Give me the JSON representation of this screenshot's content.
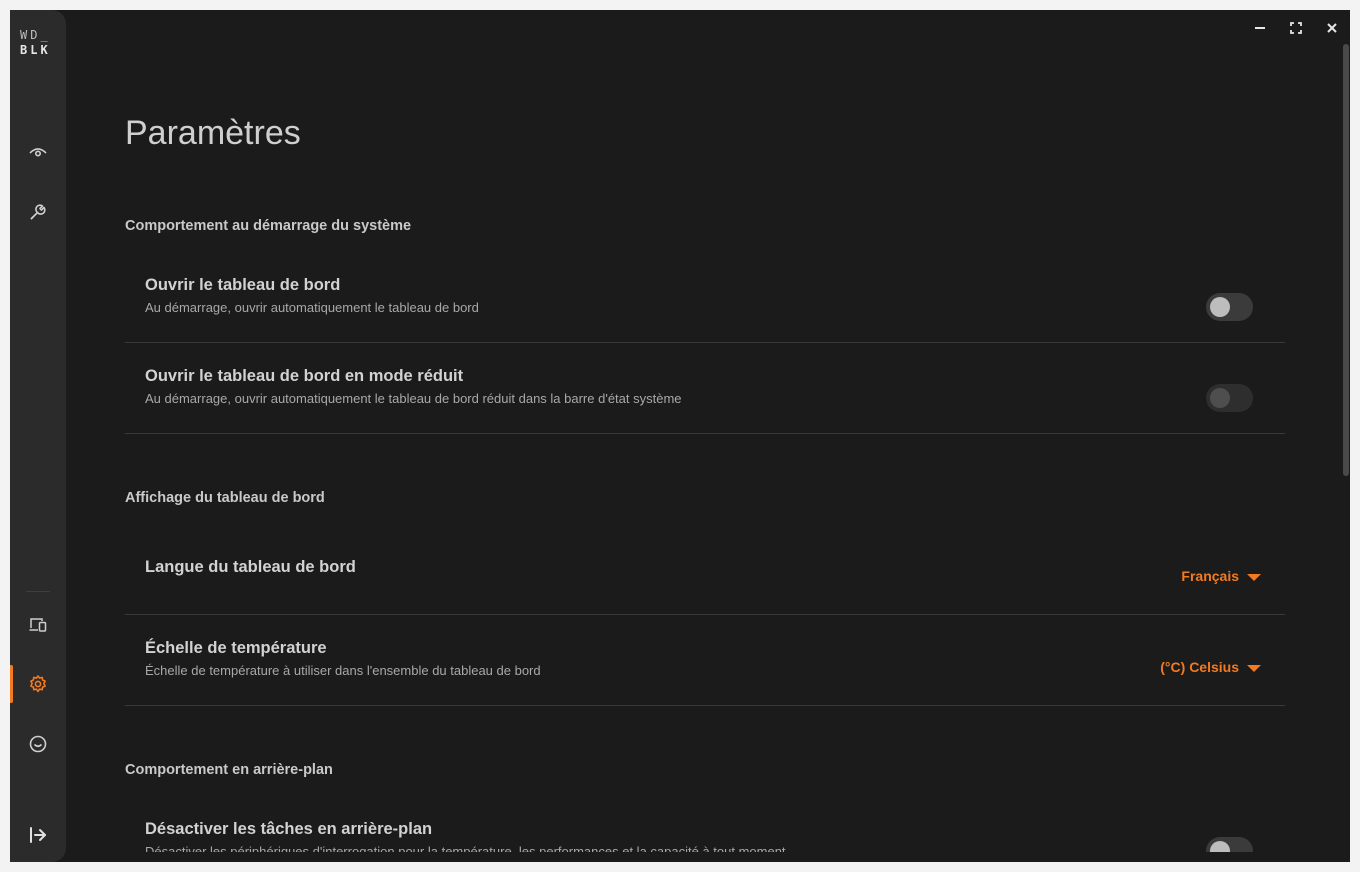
{
  "app": {
    "logo_line1": "WD_",
    "logo_line2": "BLK"
  },
  "colors": {
    "accent": "#f47a20",
    "background": "#1b1b1b",
    "sidebar": "#2b2b2b"
  },
  "sidebar": {
    "items": [
      {
        "icon": "eye-icon",
        "active": false
      },
      {
        "icon": "wrench-icon",
        "active": false
      },
      {
        "icon": "devices-icon",
        "active": false
      },
      {
        "icon": "gear-icon",
        "active": true
      },
      {
        "icon": "smiley-feedback-icon",
        "active": false
      },
      {
        "icon": "logout-arrow-icon",
        "active": false
      }
    ]
  },
  "window_controls": [
    "minimize-icon",
    "maximize-icon",
    "close-icon"
  ],
  "page": {
    "title": "Paramètres",
    "sections": [
      {
        "heading": "Comportement au démarrage du système",
        "rows": [
          {
            "title": "Ouvrir le tableau de bord",
            "description": "Au démarrage, ouvrir automatiquement le tableau de bord",
            "control": "toggle",
            "on": false
          },
          {
            "title": "Ouvrir le tableau de bord en mode réduit",
            "description": "Au démarrage, ouvrir automatiquement le tableau de bord réduit dans la barre d'état système",
            "control": "toggle",
            "on": false,
            "disabled": true
          }
        ]
      },
      {
        "heading": "Affichage du tableau de bord",
        "rows": [
          {
            "title": "Langue du tableau de bord",
            "control": "dropdown",
            "value": "Français"
          },
          {
            "title": "Échelle de température",
            "description": "Échelle de température à utiliser dans l'ensemble du tableau de bord",
            "control": "dropdown",
            "value": "(°C) Celsius"
          }
        ]
      },
      {
        "heading": "Comportement en arrière-plan",
        "rows": [
          {
            "title": "Désactiver les tâches en arrière-plan",
            "description": "Désactiver les périphériques d'interrogation pour la température, les performances et la capacité à tout moment",
            "control": "toggle",
            "on": false
          }
        ]
      }
    ]
  }
}
